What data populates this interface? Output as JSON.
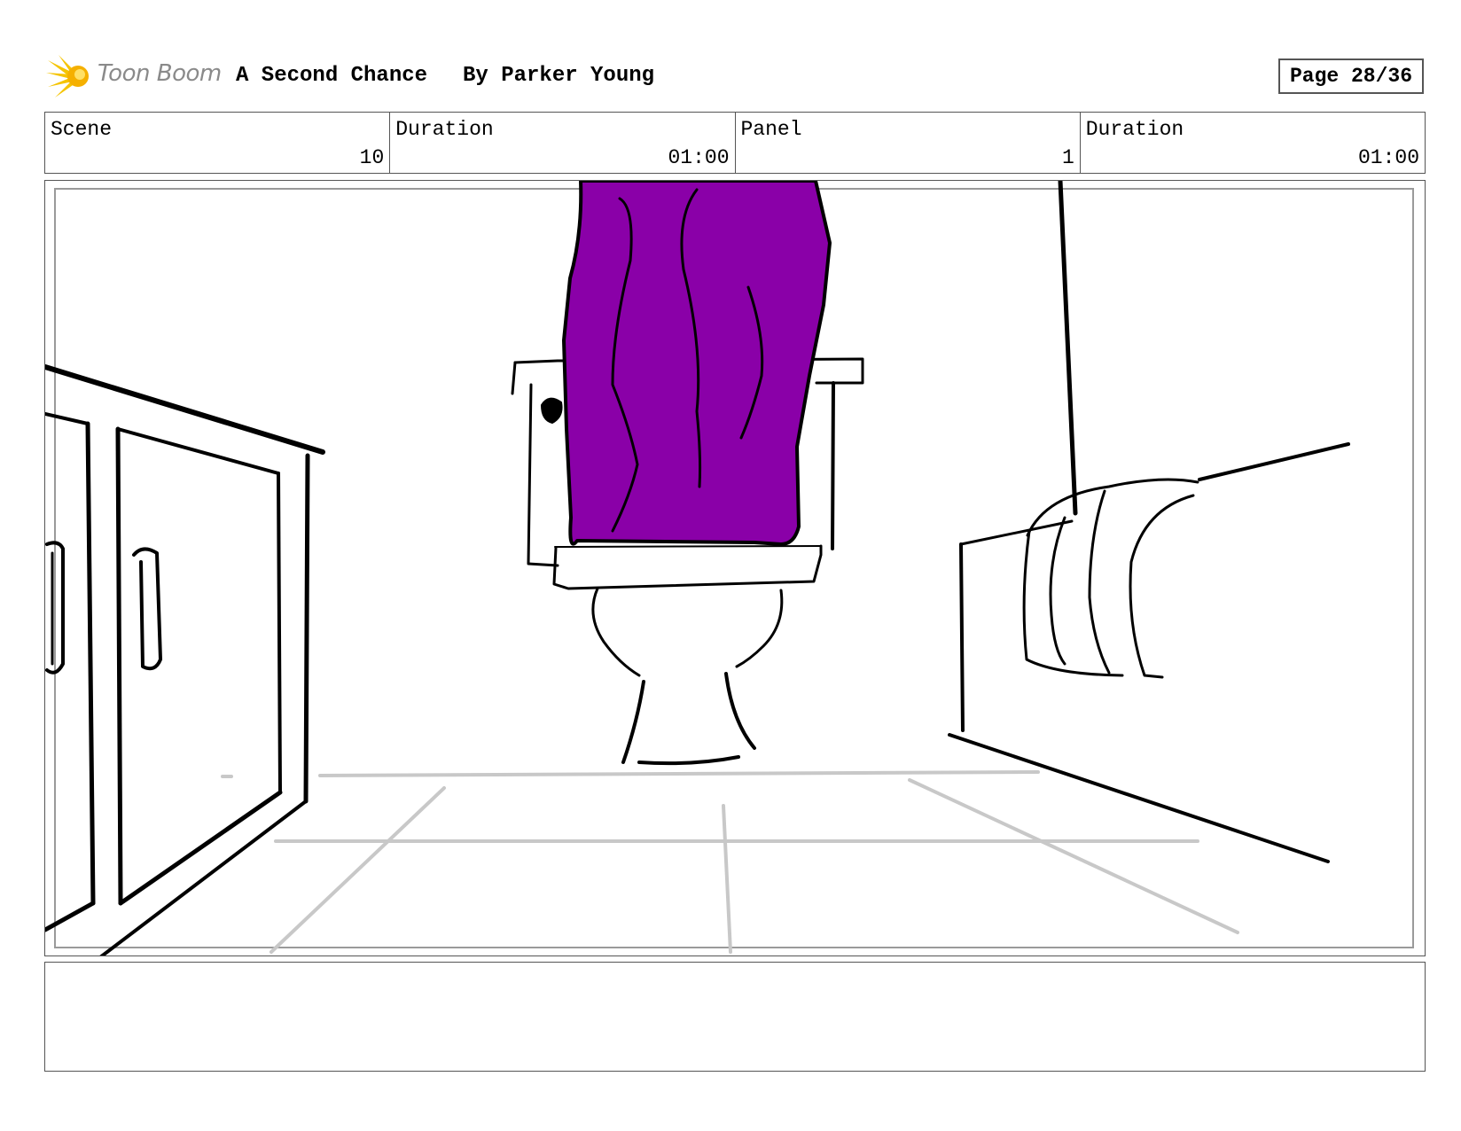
{
  "header": {
    "brand": "Toon Boom",
    "title": "A Second Chance",
    "author": "By Parker Young",
    "page": "Page 28/36"
  },
  "info": {
    "scene_label": "Scene",
    "scene_value": "10",
    "scene_duration_label": "Duration",
    "scene_duration_value": "01:00",
    "panel_label": "Panel",
    "panel_value": "1",
    "panel_duration_label": "Duration",
    "panel_duration_value": "01:00"
  },
  "panel": {
    "drawing": "toilet-storyboard-sketch",
    "accent_color": "#8a00a8",
    "floor_color": "#c8c8c8"
  },
  "notes": {
    "text": ""
  }
}
